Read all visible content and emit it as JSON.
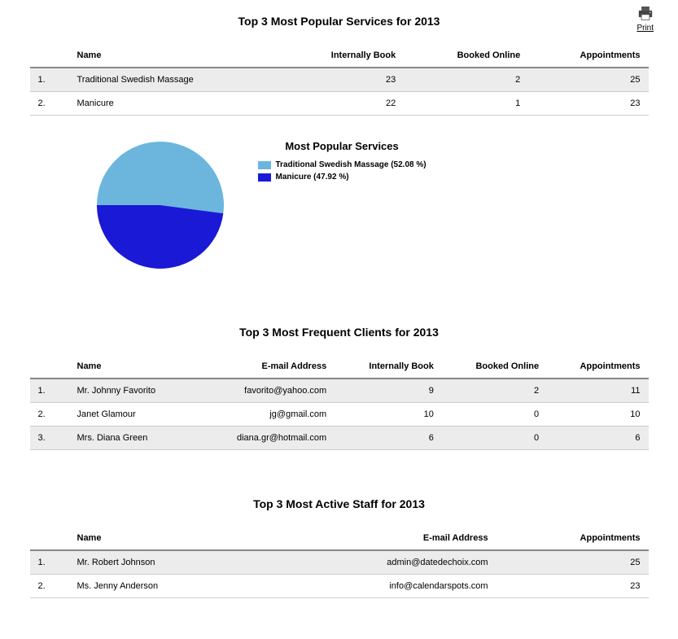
{
  "print": {
    "label": "Print"
  },
  "sections": {
    "services": {
      "title": "Top 3 Most Popular Services for 2013",
      "columns": {
        "name": "Name",
        "internal": "Internally Book",
        "online": "Booked Online",
        "appts": "Appointments"
      },
      "rows": [
        {
          "idx": "1.",
          "name": "Traditional Swedish Massage",
          "internal": 23,
          "online": 2,
          "appts": 25
        },
        {
          "idx": "2.",
          "name": "Manicure",
          "internal": 22,
          "online": 1,
          "appts": 23
        }
      ]
    },
    "clients": {
      "title": "Top 3 Most Frequent Clients for 2013",
      "columns": {
        "name": "Name",
        "email": "E-mail Address",
        "internal": "Internally Book",
        "online": "Booked Online",
        "appts": "Appointments"
      },
      "rows": [
        {
          "idx": "1.",
          "name": "Mr. Johnny Favorito",
          "email": "favorito@yahoo.com",
          "internal": 9,
          "online": 2,
          "appts": 11
        },
        {
          "idx": "2.",
          "name": "Janet Glamour",
          "email": "jg@gmail.com",
          "internal": 10,
          "online": 0,
          "appts": 10
        },
        {
          "idx": "3.",
          "name": "Mrs. Diana Green",
          "email": "diana.gr@hotmail.com",
          "internal": 6,
          "online": 0,
          "appts": 6
        }
      ]
    },
    "staff": {
      "title": "Top 3 Most Active Staff for 2013",
      "columns": {
        "name": "Name",
        "email": "E-mail Address",
        "appts": "Appointments"
      },
      "rows": [
        {
          "idx": "1.",
          "name": "Mr. Robert Johnson",
          "email": "admin@datedechoix.com",
          "appts": 25
        },
        {
          "idx": "2.",
          "name": "Ms. Jenny Anderson",
          "email": "info@calendarspots.com",
          "appts": 23
        }
      ]
    }
  },
  "chart": {
    "title": "Most Popular Services",
    "legend": [
      {
        "label": "Traditional Swedish Massage (52.08 %)",
        "color": "#6cb6de"
      },
      {
        "label": "Manicure (47.92 %)",
        "color": "#1919d6"
      }
    ]
  },
  "chart_data": {
    "type": "pie",
    "title": "Most Popular Services",
    "series": [
      {
        "name": "Traditional Swedish Massage",
        "value": 52.08,
        "color": "#6cb6de"
      },
      {
        "name": "Manicure",
        "value": 47.92,
        "color": "#1919d6"
      }
    ]
  }
}
